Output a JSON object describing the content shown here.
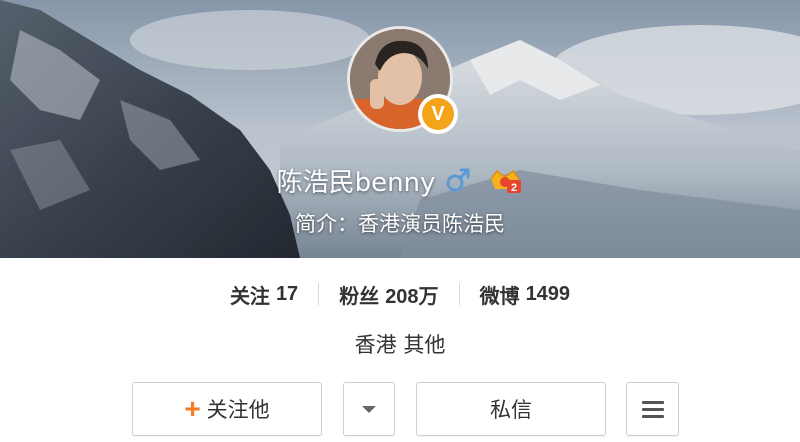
{
  "profile": {
    "username": "陈浩民benny",
    "bio": "简介：香港演员陈浩民",
    "verified_mark": "V",
    "verified_color": "#f4a41a",
    "gender_icon": "male-icon",
    "gender_color": "#5b9bd5",
    "level_icon": "vip-level-icon",
    "level_digit": "2"
  },
  "stats": {
    "following_label": "关注",
    "following_count": "17",
    "followers_label": "粉丝",
    "followers_count": "208万",
    "posts_label": "微博",
    "posts_count": "1499"
  },
  "location": "香港 其他",
  "actions": {
    "follow_label": "关注他",
    "follow_plus": "+",
    "follow_accent": "#f77c20",
    "message_label": "私信",
    "more_icon": "chevron-down-icon",
    "menu_icon": "hamburger-icon"
  }
}
